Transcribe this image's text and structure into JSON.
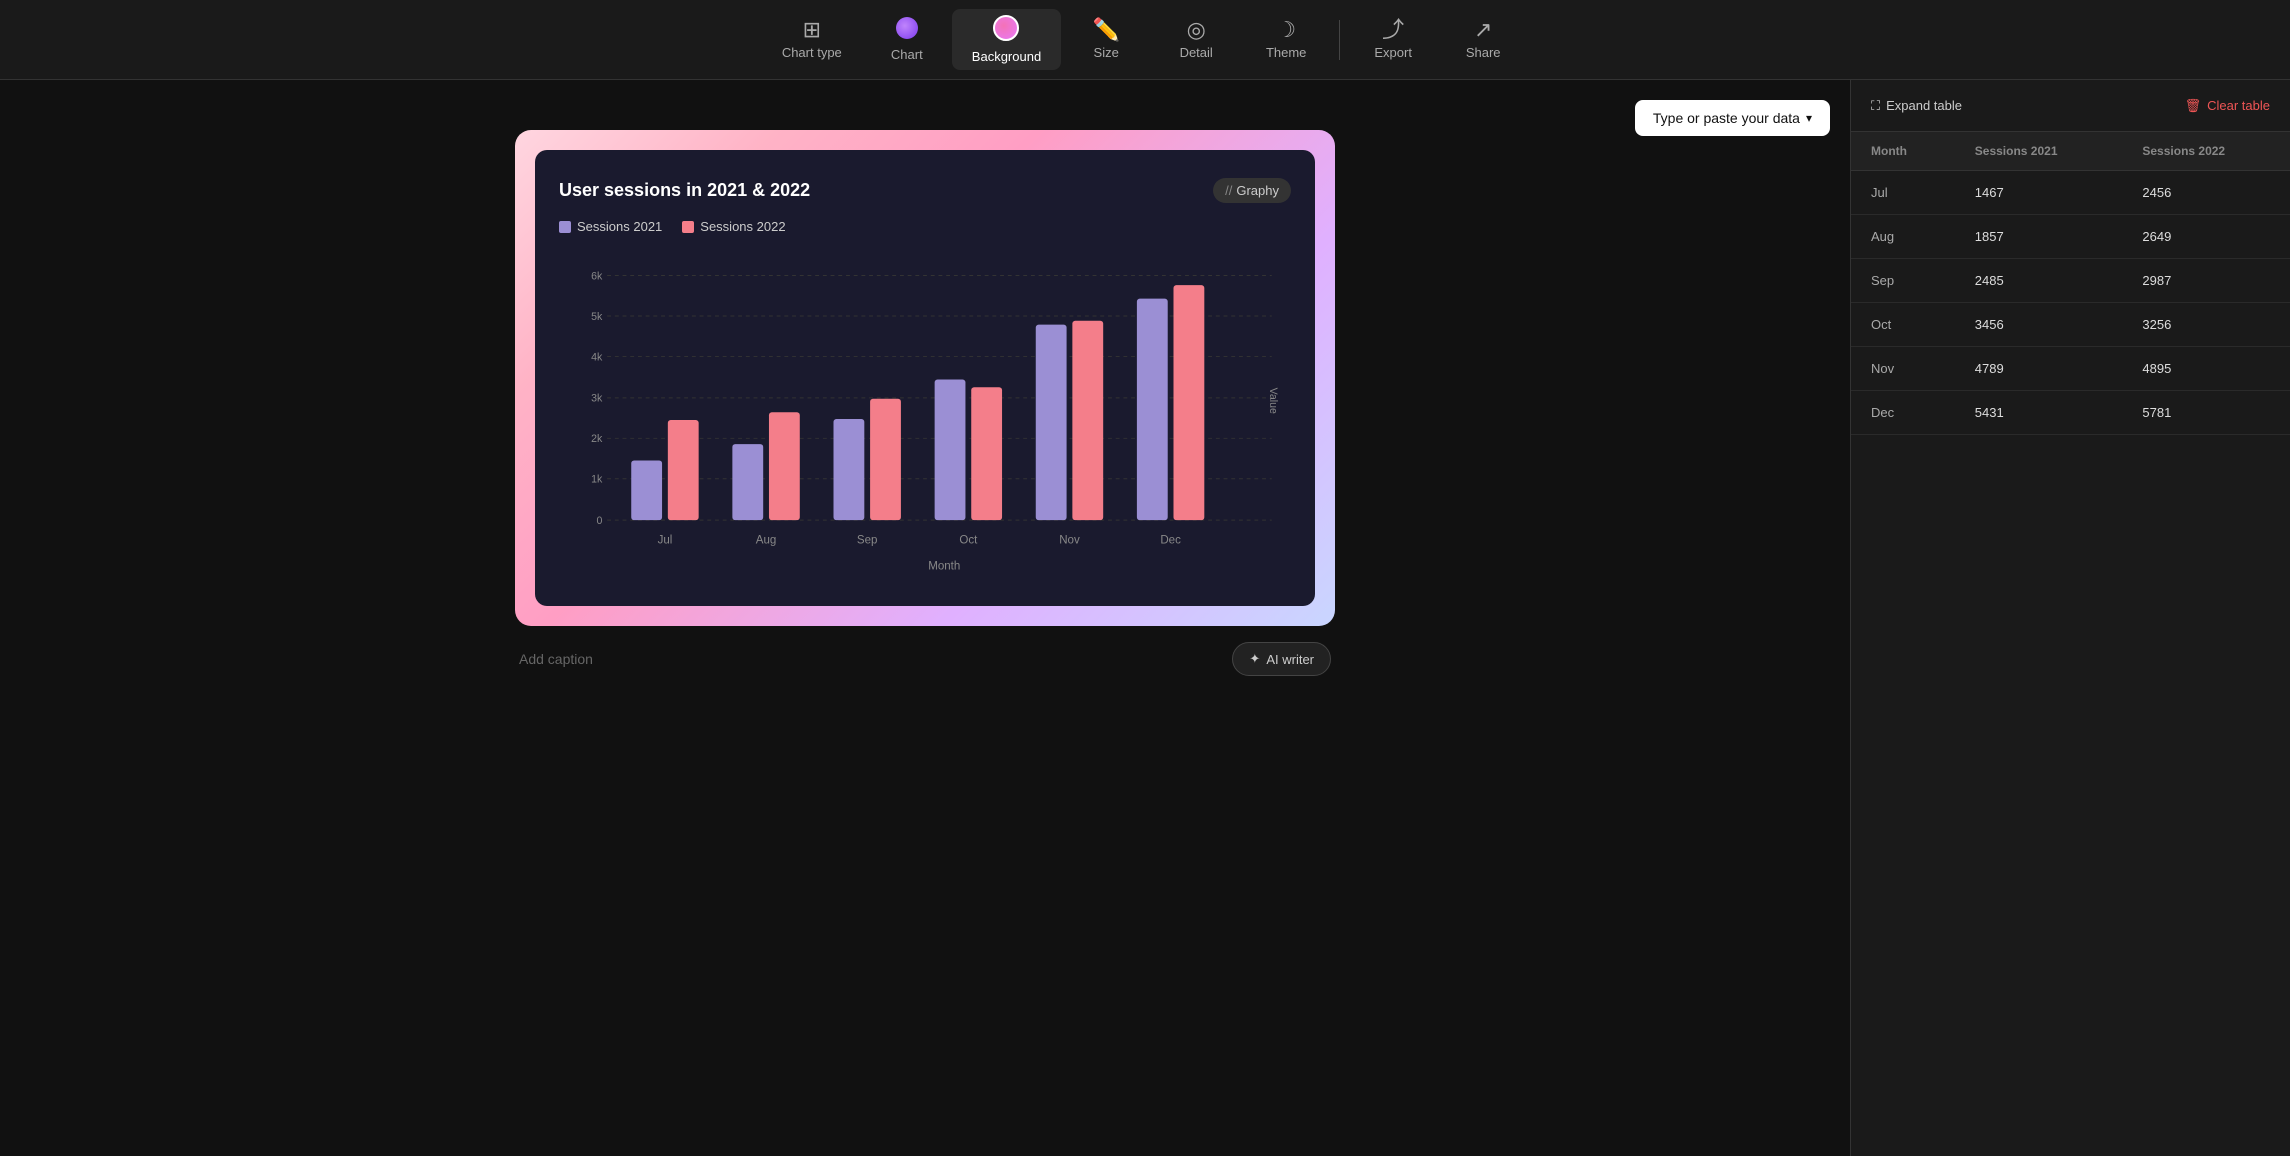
{
  "toolbar": {
    "items": [
      {
        "id": "chart-type",
        "label": "Chart type",
        "icon": "bars",
        "active": false
      },
      {
        "id": "chart",
        "label": "Chart",
        "icon": "circle-purple",
        "active": false
      },
      {
        "id": "background",
        "label": "Background",
        "icon": "circle-active",
        "active": true
      },
      {
        "id": "size",
        "label": "Size",
        "icon": "pencil",
        "active": false
      },
      {
        "id": "detail",
        "label": "Detail",
        "icon": "eye",
        "active": false
      },
      {
        "id": "theme",
        "label": "Theme",
        "icon": "moon",
        "active": false
      }
    ],
    "export_label": "Export",
    "share_label": "Share"
  },
  "canvas": {
    "paste_button": "Type or paste your data",
    "chart": {
      "title": "User sessions in 2021 & 2022",
      "logo": "Graphy",
      "legend": [
        {
          "id": "sessions2021",
          "label": "Sessions 2021",
          "color": "#9b8fd4"
        },
        {
          "id": "sessions2022",
          "label": "Sessions 2022",
          "color": "#f47e8a"
        }
      ],
      "x_axis_label": "Month",
      "y_axis_label": "Value",
      "months": [
        "Jul",
        "Aug",
        "Sep",
        "Oct",
        "Nov",
        "Dec"
      ],
      "sessions_2021": [
        1467,
        1857,
        2485,
        3456,
        4789,
        5431
      ],
      "sessions_2022": [
        2456,
        2649,
        2987,
        3256,
        4895,
        5781
      ],
      "y_ticks": [
        0,
        "1k",
        "2k",
        "3k",
        "4k",
        "5k",
        "6k"
      ],
      "y_max": 6000
    },
    "caption_placeholder": "Add caption",
    "ai_writer_label": "AI writer"
  },
  "table": {
    "expand_label": "Expand table",
    "clear_label": "Clear table",
    "columns": [
      "Month",
      "Sessions 2021",
      "Sessions 2022"
    ],
    "rows": [
      {
        "month": "Jul",
        "sessions2021": "1467",
        "sessions2022": "2456"
      },
      {
        "month": "Aug",
        "sessions2021": "1857",
        "sessions2022": "2649"
      },
      {
        "month": "Sep",
        "sessions2021": "2485",
        "sessions2022": "2987"
      },
      {
        "month": "Oct",
        "sessions2021": "3456",
        "sessions2022": "3256"
      },
      {
        "month": "Nov",
        "sessions2021": "4789",
        "sessions2022": "4895"
      },
      {
        "month": "Dec",
        "sessions2021": "5431",
        "sessions2022": "5781"
      }
    ]
  }
}
